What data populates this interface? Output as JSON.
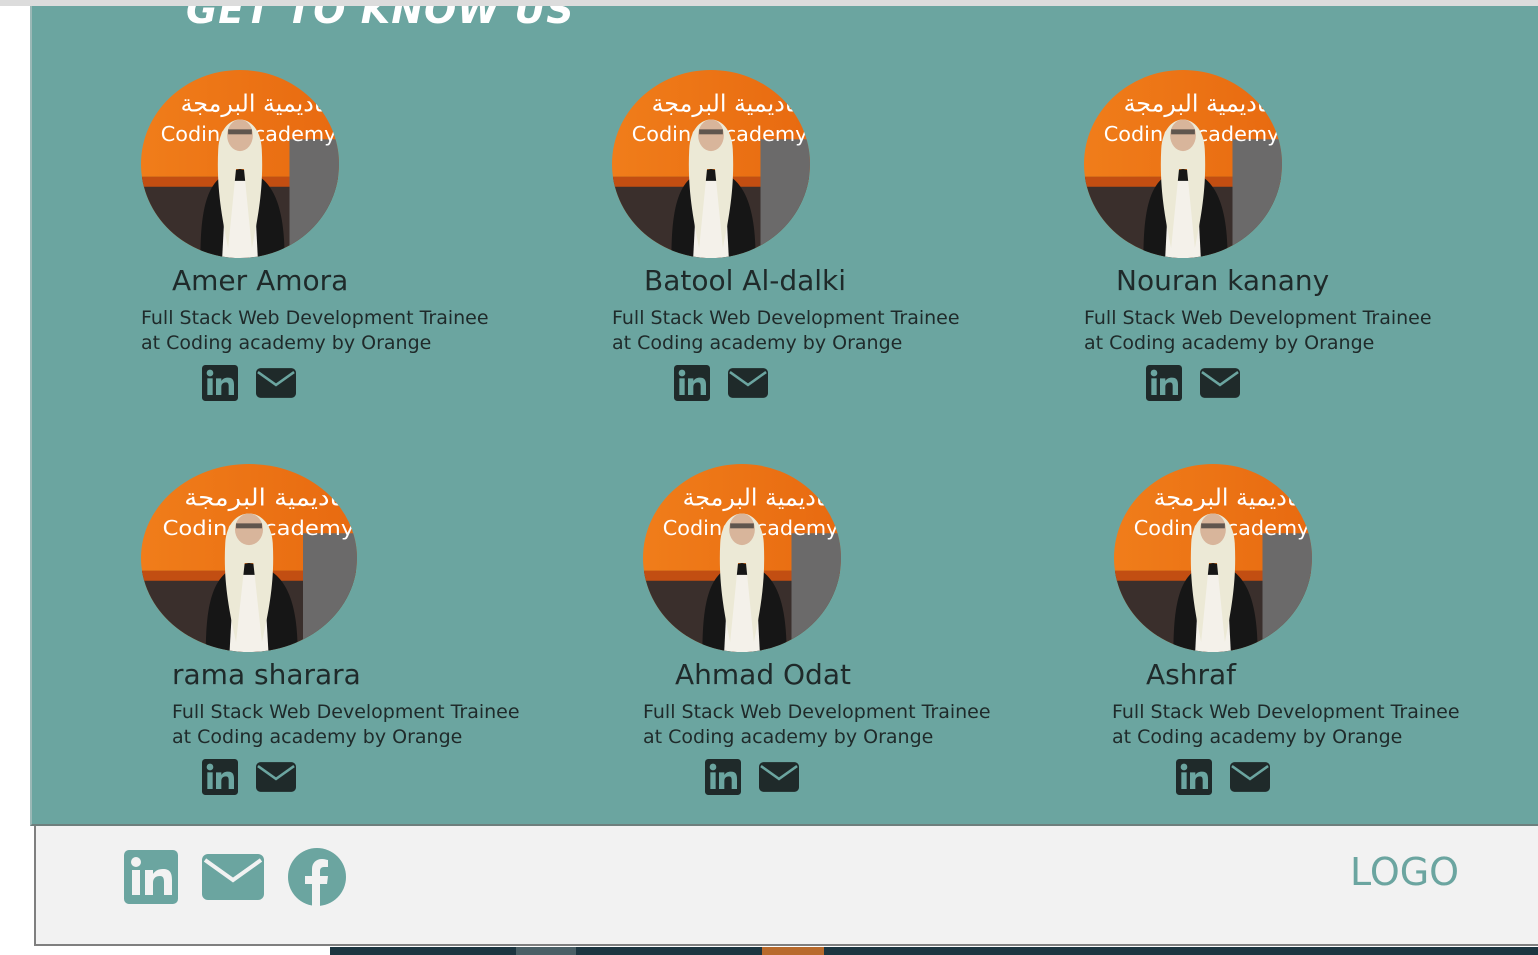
{
  "section": {
    "heading": "GET TO KNOW US"
  },
  "team": [
    {
      "name": "Amer Amora",
      "role_line1": "Full Stack Web Development Trainee",
      "role_line2": "at Coding academy by Orange"
    },
    {
      "name": "Batool Al-dalki",
      "role_line1": "Full Stack Web Development Trainee",
      "role_line2": "at Coding academy by Orange"
    },
    {
      "name": "Nouran kanany",
      "role_line1": "Full Stack Web Development Trainee",
      "role_line2": "at Coding academy by Orange"
    },
    {
      "name": "rama sharara",
      "role_line1": "Full Stack Web Development Trainee",
      "role_line2": "at Coding academy by Orange"
    },
    {
      "name": "Ahmad Odat",
      "role_line1": "Full Stack Web Development Trainee",
      "role_line2": "at Coding academy by Orange"
    },
    {
      "name": "Ashraf",
      "role_line1": "Full Stack Web Development Trainee",
      "role_line2": "at Coding academy by Orange"
    }
  ],
  "photo": {
    "sign_line1": "أكاديمية البرمجة",
    "sign_line2": "Coding Academy"
  },
  "card_icons": [
    "linkedin-icon",
    "envelope-icon"
  ],
  "footer": {
    "logo": "LOGO",
    "icons": [
      "linkedin-icon",
      "envelope-icon",
      "facebook-icon"
    ]
  },
  "colors": {
    "section_bg": "#6ba5a0",
    "text_dark": "#1f2a2a",
    "footer_bg": "#f2f2f2",
    "accent": "#6ba5a0",
    "sign_orange": "#f07d1a"
  }
}
